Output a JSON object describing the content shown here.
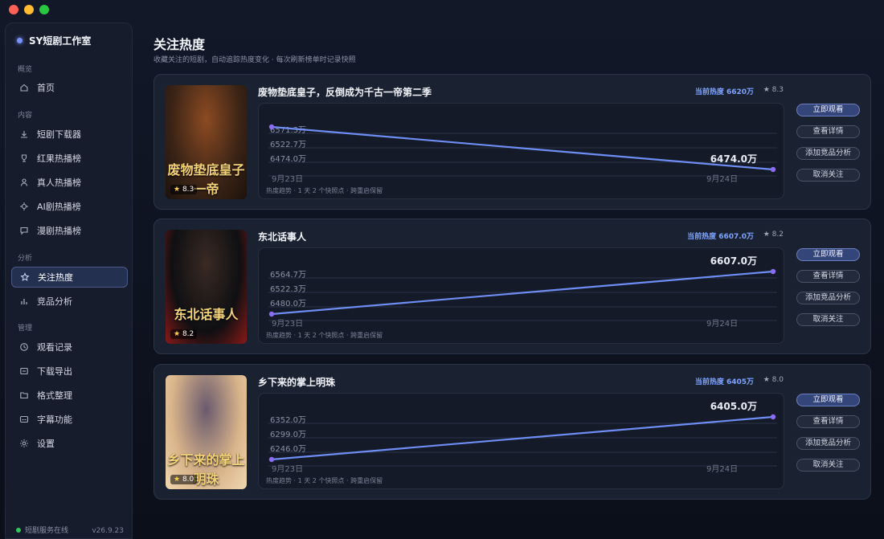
{
  "sidebar": {
    "brand": "SY短剧工作室",
    "sections": [
      {
        "label": "概览",
        "items": [
          {
            "label": "首页",
            "icon": "home-icon"
          }
        ]
      },
      {
        "label": "内容",
        "items": [
          {
            "label": "短剧下载器",
            "icon": "download-icon"
          },
          {
            "label": "红果热播榜",
            "icon": "trophy-icon"
          },
          {
            "label": "真人热播榜",
            "icon": "user-icon"
          },
          {
            "label": "AI剧热播榜",
            "icon": "chip-icon"
          },
          {
            "label": "漫剧热播榜",
            "icon": "comment-icon"
          }
        ]
      },
      {
        "label": "分析",
        "items": [
          {
            "label": "关注热度",
            "icon": "star-icon",
            "active": true
          },
          {
            "label": "竞品分析",
            "icon": "bar-chart-icon"
          }
        ]
      },
      {
        "label": "管理",
        "items": [
          {
            "label": "观看记录",
            "icon": "clock-icon"
          },
          {
            "label": "下载导出",
            "icon": "export-icon"
          },
          {
            "label": "格式整理",
            "icon": "folder-icon"
          },
          {
            "label": "字幕功能",
            "icon": "subtitle-icon"
          },
          {
            "label": "设置",
            "icon": "gear-icon"
          }
        ]
      }
    ],
    "status": "短剧服务在线",
    "version": "v26.9.23"
  },
  "page": {
    "title": "关注热度",
    "subtitle": "收藏关注的短剧，自动追踪热度变化 · 每次刷新榜单时记录快照"
  },
  "buttons": {
    "watch": "立即观看",
    "details": "查看详情",
    "compete": "添加竞品分析",
    "unfollow": "取消关注"
  },
  "chart_note": "热度趋势 · 1 天 2 个快照点 · 跨重启保留",
  "chart_data": [
    {
      "type": "line",
      "drama": "废物垫底皇子，反倒成为千古一帝第二季",
      "current_heat": "当前热度 6620万",
      "score": "8.3",
      "x": [
        "9月23日",
        "9月24日"
      ],
      "values": [
        6571.3,
        6474.0
      ],
      "yticks": [
        "6571.3万",
        "6522.7万",
        "6474.0万"
      ],
      "ylim": [
        6474.0,
        6571.3
      ],
      "end_label": "6474.0万",
      "poster_text": "废物垫底皇子一帝",
      "poster_colors": [
        "#3b2416",
        "#8c4a22",
        "#1c120c"
      ]
    },
    {
      "type": "line",
      "drama": "东北话事人",
      "current_heat": "当前热度 6607.0万",
      "score": "8.2",
      "x": [
        "9月23日",
        "9月24日"
      ],
      "values": [
        6480.0,
        6607.0
      ],
      "yticks": [
        "6564.7万",
        "6522.3万",
        "6480.0万"
      ],
      "ylim": [
        6480.0,
        6607.0
      ],
      "end_label": "6607.0万",
      "poster_text": "东北话事人",
      "poster_colors": [
        "#0f0f12",
        "#3a2a24",
        "#8a1a18"
      ]
    },
    {
      "type": "line",
      "drama": "乡下来的掌上明珠",
      "current_heat": "当前热度 6405万",
      "score": "8.0",
      "x": [
        "9月23日",
        "9月24日"
      ],
      "values": [
        6246.0,
        6405.0
      ],
      "yticks": [
        "6352.0万",
        "6299.0万",
        "6246.0万"
      ],
      "ylim": [
        6246.0,
        6405.0
      ],
      "end_label": "6405.0万",
      "poster_text": "乡下来的掌上明珠",
      "poster_colors": [
        "#d9b48a",
        "#6a5a6e",
        "#f0d7b0"
      ]
    }
  ]
}
